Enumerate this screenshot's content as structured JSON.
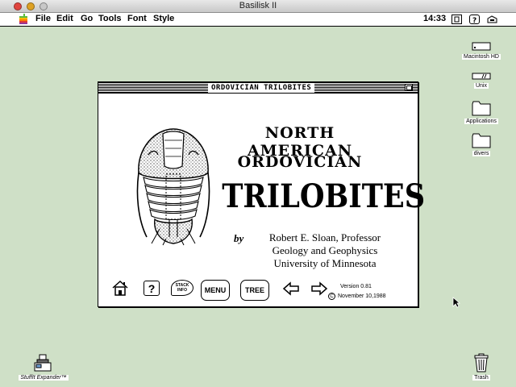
{
  "host": {
    "title": "Basilisk II",
    "colors": {
      "close": "#e0443e",
      "minimize": "#dea123",
      "zoom": "#c8c8c8"
    }
  },
  "menubar": {
    "items": [
      "File",
      "Edit",
      "Go",
      "Tools",
      "Font",
      "Style"
    ],
    "clock": "14:33",
    "status_icons": [
      "keyboard-layout-icon",
      "help-balloon-icon",
      "application-menu-icon"
    ]
  },
  "desktop": {
    "background": "#cfe0c7",
    "icons": [
      {
        "label": "Macintosh HD",
        "icon": "hard-disk-icon"
      },
      {
        "label": "Unix",
        "icon": "drive-icon"
      },
      {
        "label": "Applications",
        "icon": "folder-icon"
      },
      {
        "label": "divers",
        "icon": "folder-icon"
      },
      {
        "label": "StuffIt Expander™",
        "icon": "stuffit-icon"
      },
      {
        "label": "Trash",
        "icon": "trash-icon"
      }
    ]
  },
  "stack": {
    "title": "ORDOVICIAN TRILOBITES",
    "heading_lines": [
      "NORTH AMERICAN",
      "ORDOVICIAN",
      "TRILOBITES"
    ],
    "by": "by",
    "author_lines": [
      "Robert E. Sloan, Professor",
      "Geology and Geophysics",
      "University of Minnesota"
    ],
    "buttons": {
      "home_icon": "home-icon",
      "help": "?",
      "stack_info": "STACK INFO",
      "menu": "MENU",
      "tree": "TREE",
      "back_icon": "arrow-left-icon",
      "forward_icon": "arrow-right-icon"
    },
    "version": "Version 0.81",
    "copyright_symbol": "C",
    "date": "November 10,1988"
  }
}
